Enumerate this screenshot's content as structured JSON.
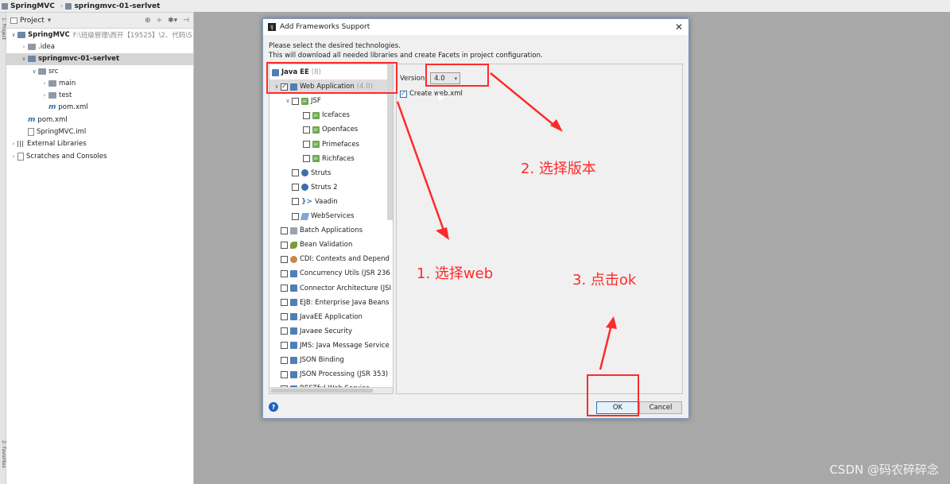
{
  "breadcrumb": {
    "items": [
      "SpringMVC",
      "springmvc-01-serlvet"
    ]
  },
  "left_stripe": {
    "top_label": "1: Project",
    "bottom_label": "2: Favorites"
  },
  "project_panel": {
    "title": "Project",
    "tree": [
      {
        "indent": 0,
        "expand": "v",
        "icon": "folder-blue",
        "label": "SpringMVC",
        "bold": true,
        "path": "F:\\班级管理\\西开【19525】\\2、代码\\S",
        "selected": false
      },
      {
        "indent": 1,
        "expand": ">",
        "icon": "folder",
        "label": ".idea",
        "bold": false,
        "path": "",
        "selected": false
      },
      {
        "indent": 1,
        "expand": "v",
        "icon": "folder-blue",
        "label": "springmvc-01-serlvet",
        "bold": true,
        "path": "",
        "selected": true
      },
      {
        "indent": 2,
        "expand": "v",
        "icon": "folder",
        "label": "src",
        "bold": false,
        "path": "",
        "selected": false
      },
      {
        "indent": 3,
        "expand": ">",
        "icon": "folder",
        "label": "main",
        "bold": false,
        "path": "",
        "selected": false
      },
      {
        "indent": 3,
        "expand": ">",
        "icon": "folder",
        "label": "test",
        "bold": false,
        "path": "",
        "selected": false
      },
      {
        "indent": 3,
        "expand": "",
        "icon": "maven",
        "label": "pom.xml",
        "bold": false,
        "path": "",
        "selected": false
      },
      {
        "indent": 1,
        "expand": "",
        "icon": "maven",
        "label": "pom.xml",
        "bold": false,
        "path": "",
        "selected": false
      },
      {
        "indent": 1,
        "expand": "",
        "icon": "file",
        "label": "SpringMVC.iml",
        "bold": false,
        "path": "",
        "selected": false
      },
      {
        "indent": 0,
        "expand": ">",
        "icon": "libs",
        "label": "External Libraries",
        "bold": false,
        "path": "",
        "selected": false
      },
      {
        "indent": 0,
        "expand": ">",
        "icon": "scratch",
        "label": "Scratches and Consoles",
        "bold": false,
        "path": "",
        "selected": false
      }
    ]
  },
  "dialog": {
    "title": "Add Frameworks Support",
    "description_line1": "Please select the desired technologies.",
    "description_line2": "This will download all needed libraries and create Facets in project configuration.",
    "frameworks": [
      {
        "indent": 0,
        "expand": "",
        "checkbox": "none",
        "icon": "javaee",
        "label": "Java EE",
        "bold": true,
        "suffix": "(8)",
        "highlight": false
      },
      {
        "indent": 0,
        "expand": "v",
        "checkbox": "checked",
        "icon": "blue",
        "label": "Web Application",
        "bold": false,
        "suffix": "(4.0)",
        "highlight": true
      },
      {
        "indent": 1,
        "expand": "v",
        "checkbox": "empty",
        "icon": "jsf",
        "label": "JSF",
        "bold": false,
        "suffix": "",
        "highlight": false
      },
      {
        "indent": 2,
        "expand": "",
        "checkbox": "empty",
        "icon": "jsf",
        "label": "Icefaces",
        "bold": false,
        "suffix": "",
        "highlight": false
      },
      {
        "indent": 2,
        "expand": "",
        "checkbox": "empty",
        "icon": "jsf",
        "label": "Openfaces",
        "bold": false,
        "suffix": "",
        "highlight": false
      },
      {
        "indent": 2,
        "expand": "",
        "checkbox": "empty",
        "icon": "jsf",
        "label": "Primefaces",
        "bold": false,
        "suffix": "",
        "highlight": false
      },
      {
        "indent": 2,
        "expand": "",
        "checkbox": "empty",
        "icon": "jsf",
        "label": "Richfaces",
        "bold": false,
        "suffix": "",
        "highlight": false
      },
      {
        "indent": 1,
        "expand": "",
        "checkbox": "empty",
        "icon": "gear",
        "label": "Struts",
        "bold": false,
        "suffix": "",
        "highlight": false
      },
      {
        "indent": 1,
        "expand": "",
        "checkbox": "empty",
        "icon": "gear",
        "label": "Struts 2",
        "bold": false,
        "suffix": "",
        "highlight": false
      },
      {
        "indent": 1,
        "expand": "",
        "checkbox": "empty",
        "icon": "vaadin",
        "label": "Vaadin",
        "bold": false,
        "suffix": "",
        "highlight": false
      },
      {
        "indent": 1,
        "expand": "",
        "checkbox": "empty",
        "icon": "ws",
        "label": "WebServices",
        "bold": false,
        "suffix": "",
        "highlight": false
      },
      {
        "indent": 0,
        "expand": "",
        "checkbox": "empty",
        "icon": "grey",
        "label": "Batch Applications",
        "bold": false,
        "suffix": "",
        "highlight": false
      },
      {
        "indent": 0,
        "expand": "",
        "checkbox": "empty",
        "icon": "bean",
        "label": "Bean Validation",
        "bold": false,
        "suffix": "",
        "highlight": false
      },
      {
        "indent": 0,
        "expand": "",
        "checkbox": "empty",
        "icon": "cdi",
        "label": "CDI: Contexts and Depend",
        "bold": false,
        "suffix": "",
        "highlight": false
      },
      {
        "indent": 0,
        "expand": "",
        "checkbox": "empty",
        "icon": "blue",
        "label": "Concurrency Utils (JSR 236",
        "bold": false,
        "suffix": "",
        "highlight": false
      },
      {
        "indent": 0,
        "expand": "",
        "checkbox": "empty",
        "icon": "blue",
        "label": "Connector Architecture (JSI",
        "bold": false,
        "suffix": "",
        "highlight": false
      },
      {
        "indent": 0,
        "expand": "",
        "checkbox": "empty",
        "icon": "blue",
        "label": "EJB: Enterprise Java Beans",
        "bold": false,
        "suffix": "",
        "highlight": false
      },
      {
        "indent": 0,
        "expand": "",
        "checkbox": "empty",
        "icon": "blue",
        "label": "JavaEE Application",
        "bold": false,
        "suffix": "",
        "highlight": false
      },
      {
        "indent": 0,
        "expand": "",
        "checkbox": "empty",
        "icon": "blue",
        "label": "Javaee Security",
        "bold": false,
        "suffix": "",
        "highlight": false
      },
      {
        "indent": 0,
        "expand": "",
        "checkbox": "empty",
        "icon": "blue",
        "label": "JMS: Java Message Service",
        "bold": false,
        "suffix": "",
        "highlight": false
      },
      {
        "indent": 0,
        "expand": "",
        "checkbox": "empty",
        "icon": "blue",
        "label": "JSON Binding",
        "bold": false,
        "suffix": "",
        "highlight": false
      },
      {
        "indent": 0,
        "expand": "",
        "checkbox": "empty",
        "icon": "blue",
        "label": "JSON Processing (JSR 353)",
        "bold": false,
        "suffix": "",
        "highlight": false
      },
      {
        "indent": 0,
        "expand": "",
        "checkbox": "empty",
        "icon": "blue",
        "label": "RESTful Web Service",
        "bold": false,
        "suffix": "",
        "highlight": false
      }
    ],
    "version_label": "Version:",
    "version_value": "4.0",
    "create_label": "Create web.xml",
    "create_checked": true,
    "ok_label": "OK",
    "cancel_label": "Cancel",
    "help_label": "?"
  },
  "annotations": {
    "step1": "1. 选择web",
    "step2": "2. 选择版本",
    "step3": "3. 点击ok",
    "color": "#ff2a2a"
  },
  "watermark": "CSDN @码农碎碎念"
}
